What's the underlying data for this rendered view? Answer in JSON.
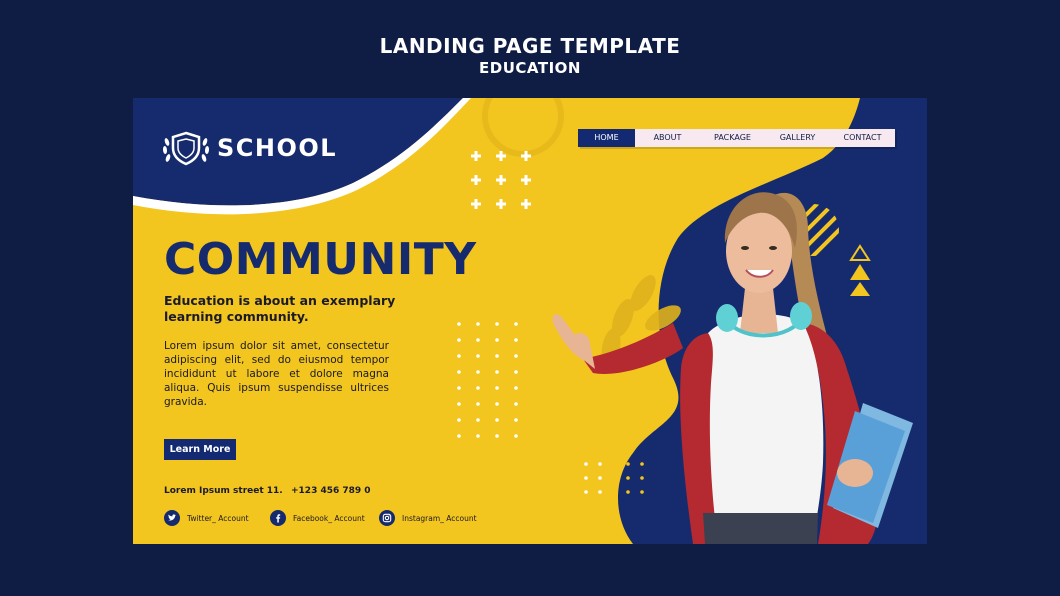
{
  "header": {
    "title": "LANDING PAGE TEMPLATE",
    "subtitle": "EDUCATION"
  },
  "logo": {
    "icon": "shield-laurel-icon",
    "name": "SCHOOL"
  },
  "nav": {
    "items": [
      {
        "label": "HOME",
        "active": true
      },
      {
        "label": "ABOUT",
        "active": false
      },
      {
        "label": "PACKAGE",
        "active": false
      },
      {
        "label": "GALLERY",
        "active": false
      },
      {
        "label": "CONTACT",
        "active": false
      }
    ]
  },
  "hero": {
    "headline": "COMMUNITY",
    "subhead": "Education is about an exemplary learning community.",
    "body": "Lorem ipsum dolor sit amet, consectetur adipiscing elit, sed do eiusmod tempor incididunt ut labore et dolore magna aliqua. Quis ipsum suspendisse ultrices gravida.",
    "cta_label": "Learn More"
  },
  "contact": {
    "address": "Lorem Ipsum street 11.",
    "phone": "+123 456 789 0"
  },
  "socials": [
    {
      "icon": "twitter-icon",
      "label": "Twitter_ Account"
    },
    {
      "icon": "facebook-icon",
      "label": "Facebook_ Account"
    },
    {
      "icon": "instagram-icon",
      "label": "Instagram_ Account"
    }
  ],
  "colors": {
    "page_bg": "#0f1d45",
    "navy": "#162b6e",
    "yellow": "#f3c51f",
    "white": "#ffffff"
  }
}
